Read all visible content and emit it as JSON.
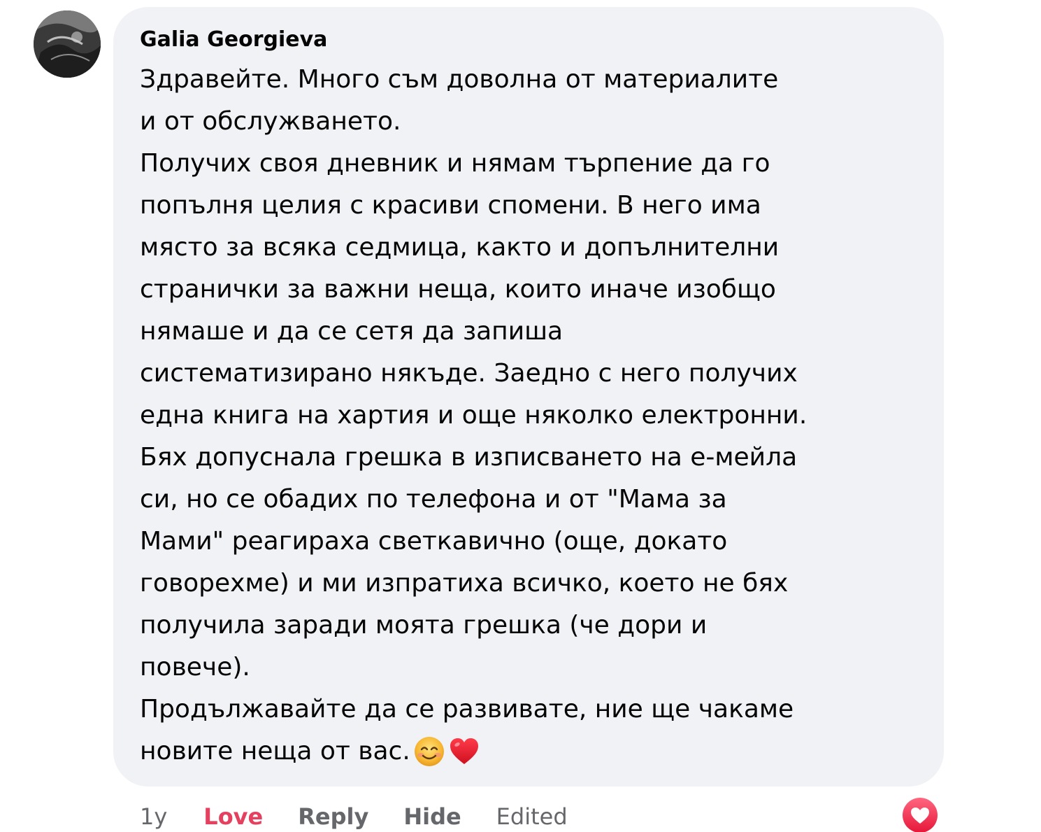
{
  "comment": {
    "author": "Galia Georgieva",
    "lines": [
      "Здравейте. Много съм доволна от материалите",
      "и от обслужването.",
      "Получих своя дневник и нямам търпение да го",
      "попълня целия с красиви спомени. В него има",
      "място за всяка седмица, както и допълнителни",
      "странички за важни неща, които иначе изобщо",
      "нямаше и да се сетя да запиша",
      "систематизирано някъде. Заедно с него получих",
      "една книга на хартия и още няколко електронни.",
      "Бях допуснала грешка в изписването на е-мейла",
      "си, но се обадих по телефона и от \"Мама за",
      "Мами\" реагираха светкавично (още, докато",
      "говорехме) и ми изпратиха всичко, което не бях",
      "получила заради моята грешка (че дори и",
      "повече).",
      "Продължавайте да се развивате, ние ще чакаме",
      "новите неща от вас."
    ],
    "emojis": [
      "smiling-face-emoji",
      "red-heart-emoji"
    ]
  },
  "actions": {
    "time": "1y",
    "love": "Love",
    "reply": "Reply",
    "hide": "Hide",
    "edited": "Edited"
  },
  "reaction": {
    "icon": "love-reaction-icon",
    "color": "#f33e58"
  },
  "colors": {
    "bubble": "#f0f2f5",
    "text": "#050505",
    "secondary": "#65676b",
    "love": "#e4405f"
  }
}
